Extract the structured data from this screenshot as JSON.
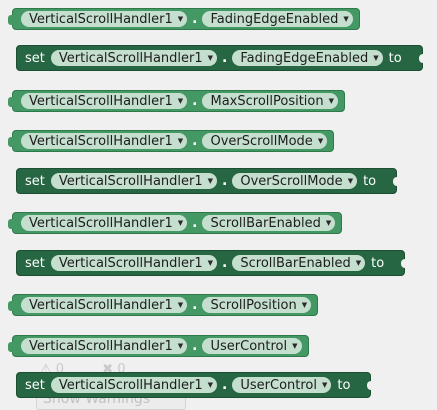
{
  "component": "VerticalScrollHandler1",
  "blocks": [
    {
      "kind": "get",
      "property": "FadingEdgeEnabled"
    },
    {
      "kind": "set",
      "keyword": "set",
      "property": "FadingEdgeEnabled",
      "to": "to"
    },
    {
      "kind": "get",
      "property": "MaxScrollPosition"
    },
    {
      "kind": "get",
      "property": "OverScrollMode"
    },
    {
      "kind": "set",
      "keyword": "set",
      "property": "OverScrollMode",
      "to": "to"
    },
    {
      "kind": "get",
      "property": "ScrollBarEnabled"
    },
    {
      "kind": "set",
      "keyword": "set",
      "property": "ScrollBarEnabled",
      "to": "to"
    },
    {
      "kind": "get",
      "property": "ScrollPosition"
    },
    {
      "kind": "get",
      "property": "UserControl"
    },
    {
      "kind": "set",
      "keyword": "set",
      "property": "UserControl",
      "to": "to"
    }
  ],
  "warnings": {
    "warning_count": "0",
    "error_count": "0",
    "show_label": "Show Warnings"
  },
  "colors": {
    "getter": "#439864",
    "setter": "#266643",
    "dropdown": "#c5dfcf"
  }
}
